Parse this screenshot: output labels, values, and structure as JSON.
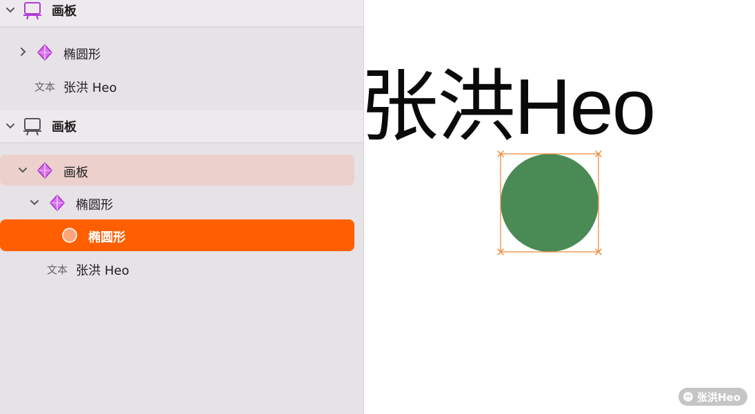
{
  "sidebar": {
    "artboard1": {
      "title": "画板",
      "chevron": "chevron-down-icon",
      "icon": "artboard-icon",
      "icon_color": "#b23ad6"
    },
    "artboard1_children": [
      {
        "type": "symbol",
        "label": "椭圆形",
        "chevron": "chevron-right-icon"
      },
      {
        "type": "text",
        "tag": "文本",
        "label": "张洪 Heo"
      }
    ],
    "artboard2": {
      "title": "画板",
      "chevron": "chevron-down-icon",
      "icon": "artboard-icon",
      "icon_color": "#555555"
    },
    "artboard2_children": [
      {
        "type": "symbol",
        "label": "画板",
        "chevron": "chevron-down-icon",
        "state": "hovered"
      },
      {
        "type": "symbol",
        "label": "椭圆形",
        "chevron": "chevron-down-icon"
      },
      {
        "type": "oval",
        "label": "椭圆形",
        "state": "selected"
      },
      {
        "type": "text",
        "tag": "文本",
        "label": "张洪 Heo"
      }
    ]
  },
  "canvas": {
    "text": "张洪Heo",
    "circle_color": "#4a8a55",
    "selection_color": "#f08a3a"
  },
  "colors": {
    "selected_row": "#ff5f00",
    "hover_row": "#ecd0cc",
    "symbol_purple": "#b23ad6"
  },
  "watermark": {
    "text": "张洪Heo"
  }
}
